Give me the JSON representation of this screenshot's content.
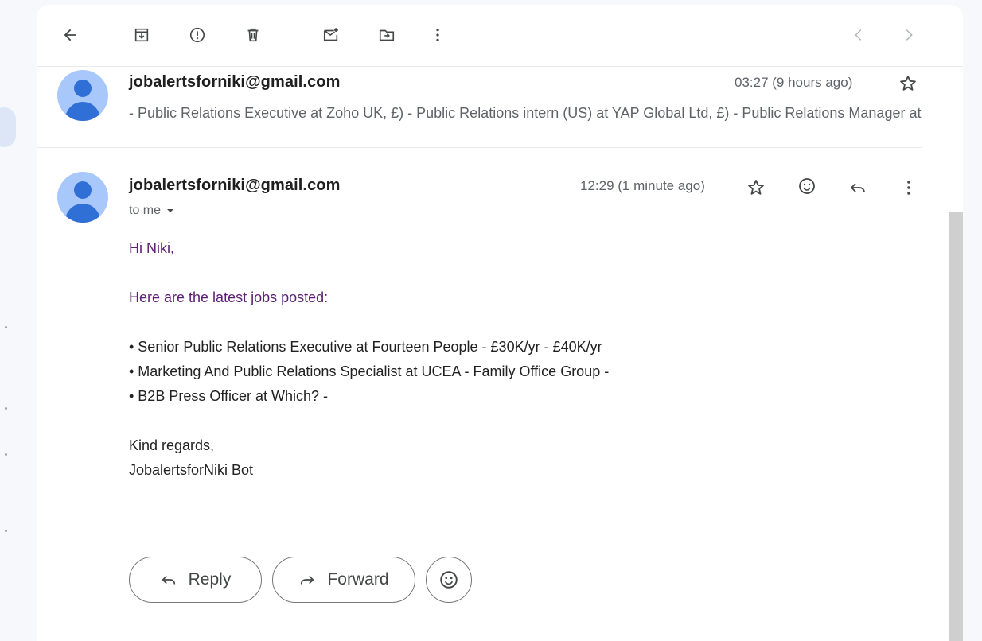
{
  "toolbar": {
    "icons": [
      "back-arrow-icon",
      "archive-icon",
      "report-spam-icon",
      "delete-icon",
      "mark-unread-icon",
      "move-to-icon",
      "more-vert-icon",
      "prev-chevron-icon",
      "next-chevron-icon"
    ]
  },
  "thread": {
    "collapsed_message": {
      "sender": "jobalertsforniki@gmail.com",
      "time": "03:27 (9 hours ago)",
      "snippet": "- Public Relations Executive at Zoho UK, £) - Public Relations intern (US) at YAP Global Ltd, £) - Public Relations Manager at"
    },
    "expanded_message": {
      "sender": "jobalertsforniki@gmail.com",
      "time": "12:29 (1 minute ago)",
      "to_label": "to me",
      "greeting": "Hi Niki,",
      "intro": "Here are the latest jobs posted:",
      "jobs": [
        "• Senior Public Relations Executive at Fourteen People - £30K/yr - £40K/yr",
        "• Marketing And Public Relations Specialist at UCEA - Family Office Group -",
        "• B2B Press Officer at Which? -"
      ],
      "signoff": "Kind regards,",
      "signature": "JobalertsforNiki Bot"
    }
  },
  "actions": {
    "reply_label": "Reply",
    "forward_label": "Forward"
  },
  "colors": {
    "avatar_bg": "#a8c7fa",
    "avatar_fg": "#2f6fd6",
    "body_purple": "#5b1f73",
    "page_bg": "#f6f8fc"
  }
}
